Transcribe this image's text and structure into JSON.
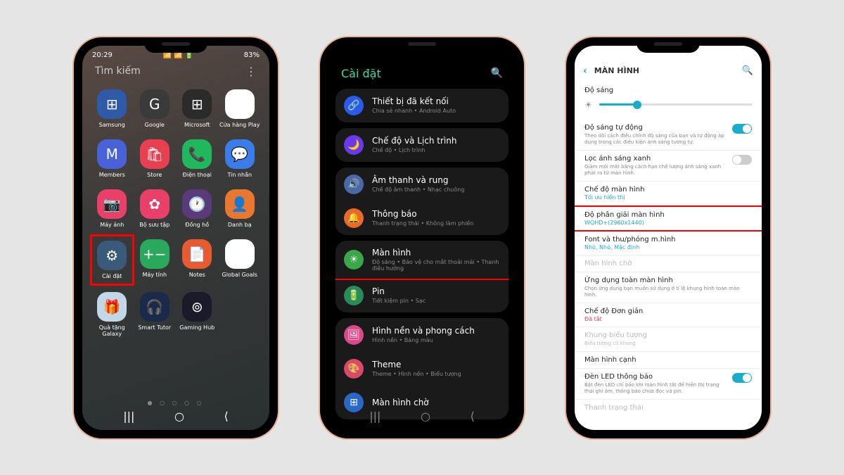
{
  "phone1": {
    "status": {
      "time": "20:29",
      "battery": "83%",
      "signals": "📶 📶 🔋"
    },
    "search": "Tìm kiếm",
    "apps": [
      {
        "label": "Samsung",
        "color": "#2e5aa8",
        "glyph": "⊞"
      },
      {
        "label": "Google",
        "color": "#3a3a3a",
        "glyph": "G"
      },
      {
        "label": "Microsoft",
        "color": "#2a2a2a",
        "glyph": "⊞"
      },
      {
        "label": "Cửa hàng Play",
        "color": "#fff",
        "glyph": "▶"
      },
      {
        "label": "Members",
        "color": "#4a62d8",
        "glyph": "M"
      },
      {
        "label": "Store",
        "color": "#e84050",
        "glyph": "🛍"
      },
      {
        "label": "Điện thoại",
        "color": "#1fb85c",
        "glyph": "📞"
      },
      {
        "label": "Tin nhắn",
        "color": "#3a7de8",
        "glyph": "💬"
      },
      {
        "label": "Máy ảnh",
        "color": "#e84068",
        "glyph": "📷"
      },
      {
        "label": "Bộ sưu tập",
        "color": "#e84068",
        "glyph": "✿"
      },
      {
        "label": "Đồng hồ",
        "color": "#5a3a7a",
        "glyph": "🕐"
      },
      {
        "label": "Danh bạ",
        "color": "#e87830",
        "glyph": "👤"
      },
      {
        "label": "Cài đặt",
        "color": "#3a5a7a",
        "glyph": "⚙",
        "highlight": true
      },
      {
        "label": "Máy tính",
        "color": "#2aa85c",
        "glyph": "+−"
      },
      {
        "label": "Notes",
        "color": "#e85a30",
        "glyph": "📄"
      },
      {
        "label": "Global Goals",
        "color": "#fff",
        "glyph": "◉"
      },
      {
        "label": "Quà tặng Galaxy",
        "color": "#c0d8e8",
        "glyph": "🎁"
      },
      {
        "label": "Smart Tutor",
        "color": "#1a2a4a",
        "glyph": "🎧"
      },
      {
        "label": "Gaming Hub",
        "color": "#1a1a2a",
        "glyph": "⊚"
      }
    ]
  },
  "phone2": {
    "title": "Cài đặt",
    "items": [
      {
        "icon": "🔗",
        "bg": "#2a5ae8",
        "label": "Thiết bị đã kết nối",
        "sub": "Chia sẻ nhanh • Android Auto"
      },
      {
        "icon": "🌙",
        "bg": "#6a3ae8",
        "label": "Chế độ và Lịch trình",
        "sub": "Chế độ • Lịch trình"
      },
      {
        "icon": "🔊",
        "bg": "#4a68a8",
        "label": "Âm thanh và rung",
        "sub": "Chế độ âm thanh • Nhạc chuông"
      },
      {
        "icon": "🔔",
        "bg": "#e86a2a",
        "label": "Thông báo",
        "sub": "Thanh trạng thái • Không làm phiền"
      },
      {
        "icon": "☀",
        "bg": "#3aa84a",
        "label": "Màn hình",
        "sub": "Độ sáng • Bảo vệ cho mắt thoải mái • Thanh điều hướng",
        "highlight": true
      },
      {
        "icon": "🔋",
        "bg": "#2a8a5a",
        "label": "Pin",
        "sub": "Tiết kiệm pin • Sạc"
      },
      {
        "icon": "🖼",
        "bg": "#d84a8a",
        "label": "Hình nền và phong cách",
        "sub": "Hình nền • Bảng màu"
      },
      {
        "icon": "🎨",
        "bg": "#d84a68",
        "label": "Theme",
        "sub": "Theme • Hình nền • Biểu tượng"
      },
      {
        "icon": "⊞",
        "bg": "#2a68c8",
        "label": "Màn hình chờ",
        "sub": ""
      }
    ]
  },
  "phone3": {
    "header": "MÀN HÌNH",
    "brightness_label": "Độ sáng",
    "auto_brightness": {
      "label": "Độ sáng tự động",
      "sub": "Theo dõi cách điều chỉnh độ sáng của bạn và tự động áp dụng trong các điều kiện ánh sáng tương tự."
    },
    "blue_light": {
      "label": "Lọc ánh sáng xanh",
      "sub": "Giảm mỏi mắt bằng cách hạn chế lượng ánh sáng xanh phát ra từ màn hình."
    },
    "screen_mode": {
      "label": "Chế độ màn hình",
      "value": "Tối ưu hiển thị"
    },
    "resolution": {
      "label": "Độ phân giải màn hình",
      "value": "WQHD+(2960x1440)"
    },
    "font_zoom": {
      "label": "Font và thu/phóng m.hình",
      "value": "Nhỏ, Nhỏ, Mặc định"
    },
    "standby": "Màn hình chờ",
    "fullscreen": {
      "label": "Ứng dụng toàn màn hình",
      "sub": "Chọn ứng dụng bạn muốn sử dụng ở tỉ lệ khung hình toàn màn hình."
    },
    "simple_mode": {
      "label": "Chế độ Đơn giản",
      "value": "Đã tắt"
    },
    "icon_frame": {
      "label": "Khung biểu tượng",
      "sub": "Biểu tượng có khung"
    },
    "edge_screen": "Màn hình cạnh",
    "led": {
      "label": "Đèn LED thông báo",
      "sub": "Bật đèn LED chỉ báo khi màn hình tắt để hiển thị trạng thái ghi âm, thông báo chưa đọc và pin."
    },
    "status_bar": "Thanh trạng thái"
  }
}
